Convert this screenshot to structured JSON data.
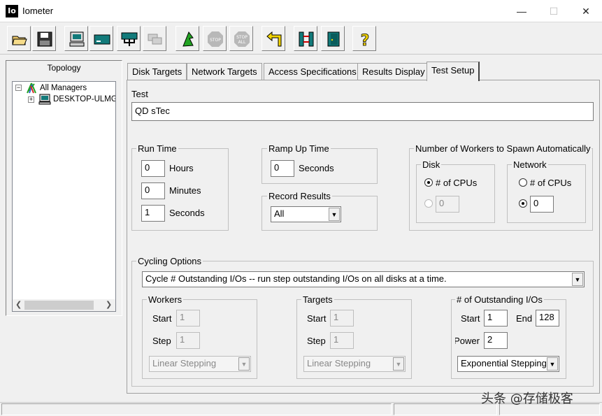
{
  "window": {
    "title": "Iometer",
    "icon_text": "Io"
  },
  "topology": {
    "title": "Topology",
    "root": "All Managers",
    "child": "DESKTOP-ULMGI"
  },
  "tabs": [
    {
      "label": "Disk Targets"
    },
    {
      "label": "Network Targets"
    },
    {
      "label": "Access Specifications"
    },
    {
      "label": "Results Display"
    },
    {
      "label": "Test Setup"
    }
  ],
  "test": {
    "label": "Test",
    "name": "QD sTec"
  },
  "run_time": {
    "label": "Run Time",
    "hours_value": "0",
    "hours_label": "Hours",
    "minutes_value": "0",
    "minutes_label": "Minutes",
    "seconds_value": "1",
    "seconds_label": "Seconds"
  },
  "ramp_up": {
    "label": "Ramp Up Time",
    "value": "0",
    "unit": "Seconds"
  },
  "record_results": {
    "label": "Record Results",
    "selected": "All"
  },
  "workers_spawn": {
    "label": "Number of Workers to Spawn Automatically",
    "disk": {
      "label": "Disk",
      "cpus_label": "# of CPUs",
      "value": "0"
    },
    "network": {
      "label": "Network",
      "cpus_label": "# of CPUs",
      "value": "0"
    }
  },
  "cycling": {
    "label": "Cycling Options",
    "selected": "Cycle # Outstanding I/Os -- run step outstanding I/Os on all disks at a time.",
    "workers": {
      "label": "Workers",
      "start_label": "Start",
      "start_value": "1",
      "step_label": "Step",
      "step_value": "1",
      "stepping": "Linear Stepping"
    },
    "targets": {
      "label": "Targets",
      "start_label": "Start",
      "start_value": "1",
      "step_label": "Step",
      "step_value": "1",
      "stepping": "Linear Stepping"
    },
    "outstanding": {
      "label": "# of Outstanding I/Os",
      "start_label": "Start",
      "start_value": "1",
      "end_label": "End",
      "end_value": "128",
      "power_label": "Power",
      "power_value": "2",
      "stepping": "Exponential Stepping"
    }
  },
  "watermark": "头条 @存储极客",
  "colors": {
    "stop_gray": "#b8b8b8",
    "green_flag": "#22a322",
    "teal": "#127a7a",
    "yellow_help": "#f2d400"
  }
}
